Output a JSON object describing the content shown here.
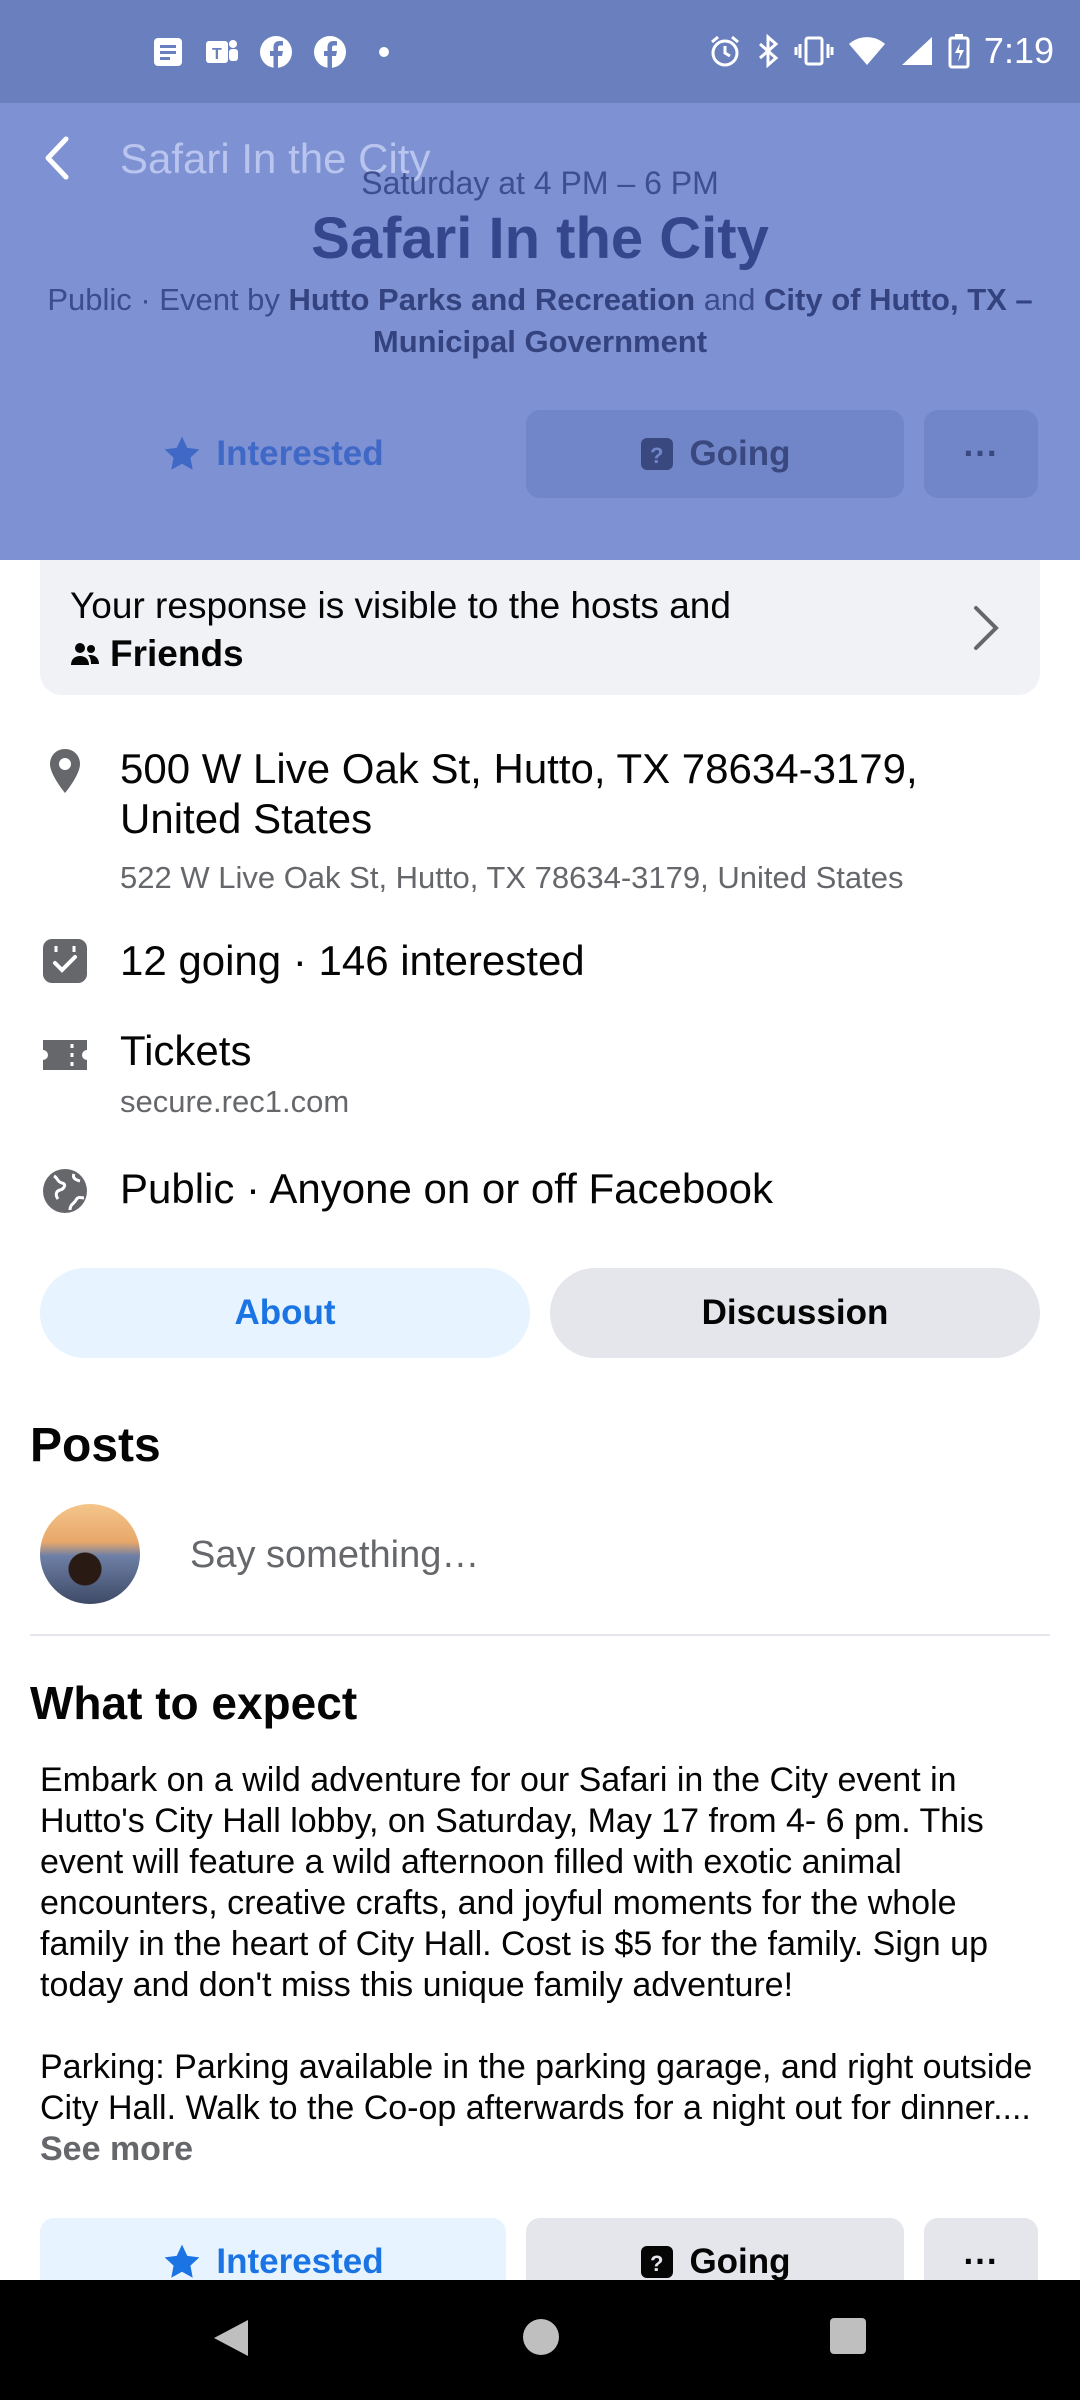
{
  "status_bar": {
    "time": "7:19"
  },
  "header": {
    "back_label": "Back",
    "title": "Safari In the City",
    "date": "Saturday at 4 PM – 6 PM",
    "event_title": "Safari In the City",
    "hosts_prefix": "Public · Event by ",
    "host1": "Hutto Parks and Recreation",
    "and_text": " and ",
    "host2": "City of Hutto, TX – Municipal Government",
    "interested_label": "Interested",
    "going_label": "Going",
    "more_label": "···"
  },
  "response": {
    "text": "Your response is visible to the hosts and",
    "audience": "Friends"
  },
  "details": {
    "address": "500 W Live Oak St, Hutto, TX 78634-3179, United States",
    "address_sub": "522 W Live Oak St, Hutto, TX 78634-3179, United States",
    "attendance": "12 going · 146 interested",
    "tickets": "Tickets",
    "tickets_url": "secure.rec1.com",
    "privacy": "Public · Anyone on or off Facebook"
  },
  "tabs": {
    "about": "About",
    "discussion": "Discussion"
  },
  "posts": {
    "heading": "Posts",
    "placeholder": "Say something…"
  },
  "expect": {
    "heading": "What to expect",
    "para1": "Embark on a wild adventure for our Safari in the City event in Hutto's City Hall lobby, on Saturday, May 17 from 4- 6 pm. This event will feature a wild afternoon filled with exotic animal encounters, creative crafts, and joyful moments for the whole family in the heart of City Hall. Cost is $5 for the family. Sign up today and don't miss this unique family adventure!",
    "para2": "Parking: Parking available in the parking garage, and right outside City Hall. Walk to the Co-op afterwards for a night out for dinner....",
    "see_more": "See more"
  },
  "bottom_actions": {
    "interested_label": "Interested",
    "going_label": "Going",
    "more_label": "···"
  },
  "colors": {
    "accent": "#1b74e4",
    "overlay": "#7d91d3",
    "muted_text": "#65676b"
  }
}
